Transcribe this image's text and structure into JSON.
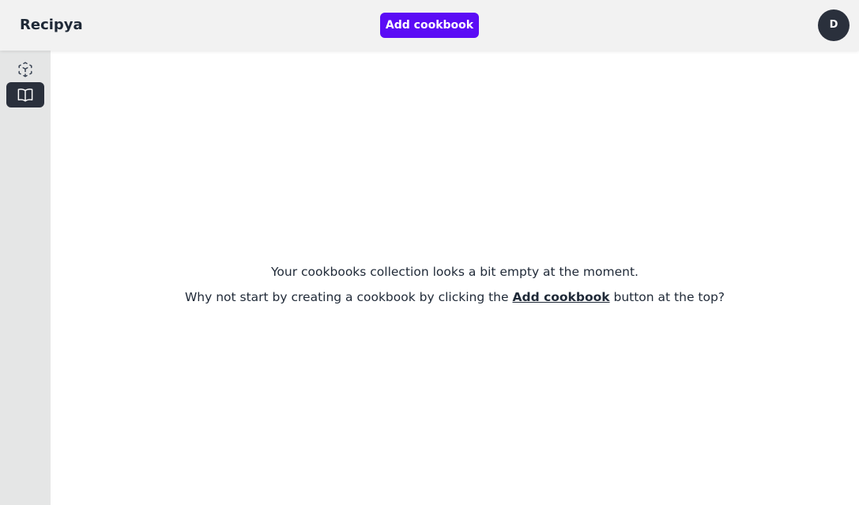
{
  "header": {
    "brand": "Recipya",
    "add_button_label": "Add cookbook",
    "avatar_initial": "D",
    "accent_color": "#5b0cf5"
  },
  "sidebar": {
    "items": [
      {
        "name": "recipes",
        "icon": "cube-scan-icon",
        "active": false
      },
      {
        "name": "cookbooks",
        "icon": "open-book-icon",
        "active": true
      }
    ]
  },
  "main": {
    "empty_line1": "Your cookbooks collection looks a bit empty at the moment.",
    "empty_line2_before": "Why not start by creating a cookbook by clicking the ",
    "empty_line2_link": "Add cookbook",
    "empty_line2_after": " button at the top?"
  }
}
